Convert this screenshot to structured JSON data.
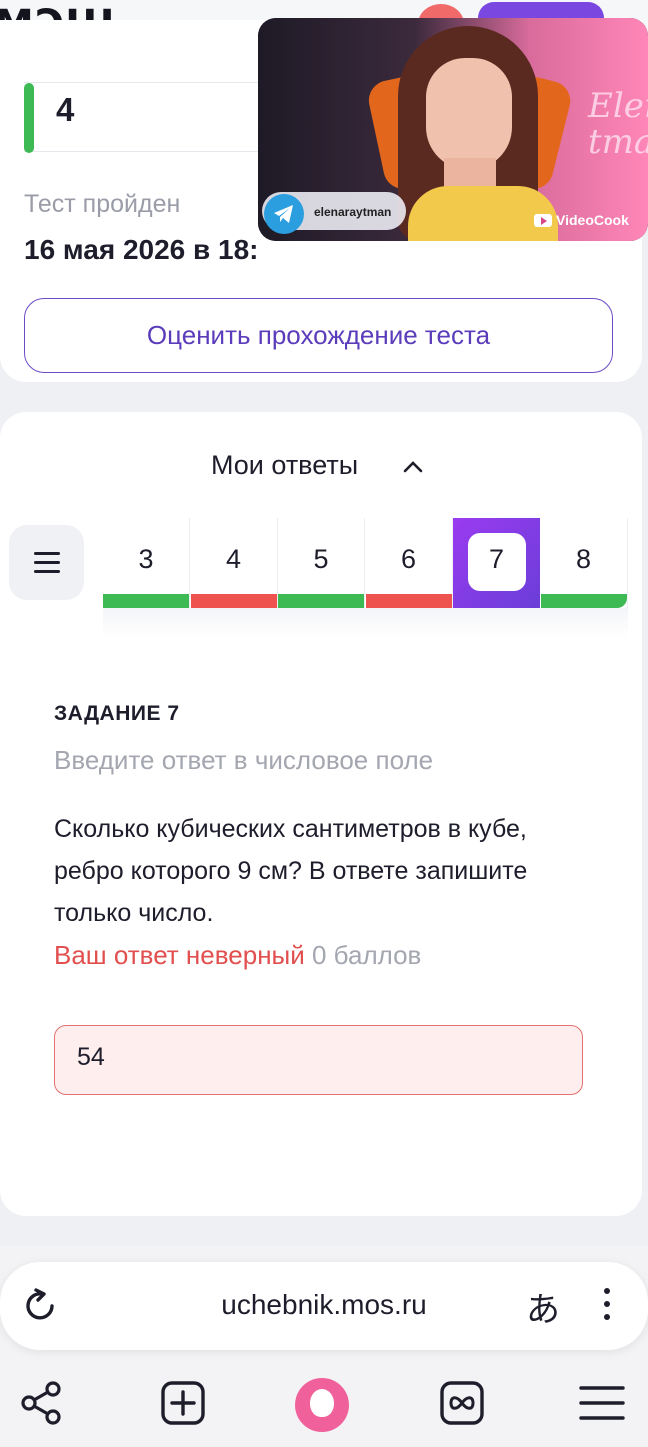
{
  "header": {
    "logo": "МЭШ",
    "chevron_icon": "chevron-down-icon"
  },
  "result": {
    "grade": "4",
    "passed_label": "Тест пройден",
    "passed_date": "16 мая 2026 в 18:",
    "rate_button": "Оценить прохождение теста"
  },
  "video": {
    "channel": "elenaraytman",
    "watermark": "VideoCook",
    "sign_text": "Elena tma"
  },
  "answers": {
    "title": "Мои ответы",
    "tasks": [
      {
        "num": "3",
        "status": "correct"
      },
      {
        "num": "4",
        "status": "wrong"
      },
      {
        "num": "5",
        "status": "correct"
      },
      {
        "num": "6",
        "status": "wrong"
      },
      {
        "num": "7",
        "status": "active"
      },
      {
        "num": "8",
        "status": "correct"
      }
    ],
    "colors": {
      "correct": "#3dba53",
      "wrong": "#ef5350",
      "accent": "#7a48e0"
    }
  },
  "task": {
    "heading": "ЗАДАНИЕ 7",
    "hint": "Введите ответ в числовое поле",
    "question": "Сколько кубических сантиметров в кубе, ребро которого 9 см? В ответе запишите только число.",
    "verdict": "Ваш ответ неверный",
    "points": "0 баллов",
    "answer_value": "54"
  },
  "browser": {
    "url": "uchebnik.mos.ru",
    "translate_glyph": "あ"
  }
}
